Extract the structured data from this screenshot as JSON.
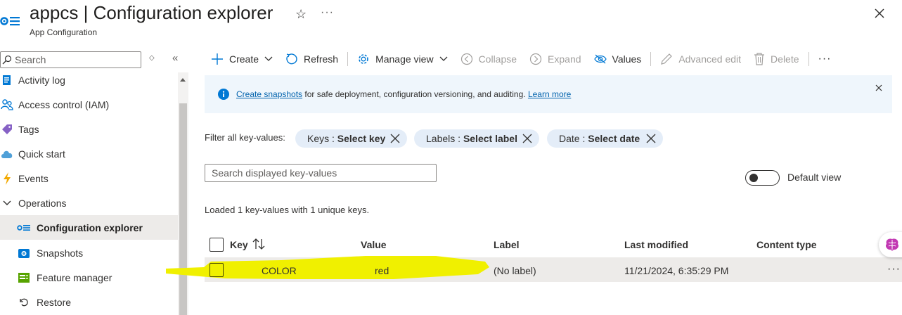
{
  "header": {
    "title": "appcs | Configuration explorer",
    "subtitle": "App Configuration",
    "more_glyph": "···"
  },
  "sidebar": {
    "search_placeholder": "Search",
    "items": [
      {
        "label": "Activity log",
        "icon": "activity-log-icon"
      },
      {
        "label": "Access control (IAM)",
        "icon": "people-icon"
      },
      {
        "label": "Tags",
        "icon": "tag-icon"
      },
      {
        "label": "Quick start",
        "icon": "cloud-icon"
      },
      {
        "label": "Events",
        "icon": "lightning-icon"
      },
      {
        "label": "Operations",
        "icon": "chevron-down-icon"
      },
      {
        "label": "Configuration explorer",
        "icon": "config-explorer-icon",
        "selected": true
      },
      {
        "label": "Snapshots",
        "icon": "camera-icon"
      },
      {
        "label": "Feature manager",
        "icon": "feature-manager-icon"
      },
      {
        "label": "Restore",
        "icon": "restore-icon"
      }
    ]
  },
  "toolbar": {
    "create": "Create",
    "refresh": "Refresh",
    "manage_view": "Manage view",
    "collapse": "Collapse",
    "expand": "Expand",
    "values": "Values",
    "advanced_edit": "Advanced edit",
    "delete": "Delete",
    "more": "···"
  },
  "banner": {
    "link1": "Create snapshots",
    "text": " for safe deployment, configuration versioning, and auditing. ",
    "link2": "Learn more"
  },
  "filters": {
    "label": "Filter all key-values:",
    "keys_prefix": "Keys : ",
    "keys_value": "Select key",
    "labels_prefix": "Labels : ",
    "labels_value": "Select label",
    "date_prefix": "Date : ",
    "date_value": "Select date"
  },
  "search": {
    "placeholder": "Search displayed key-values"
  },
  "toggle": {
    "label": "Default view",
    "on": false
  },
  "status": {
    "loaded": "Loaded 1 key-values with 1 unique keys."
  },
  "table": {
    "columns": [
      "Key",
      "Value",
      "Label",
      "Last modified",
      "Content type"
    ],
    "rows": [
      {
        "key": "COLOR",
        "value": "red",
        "label": "(No label)",
        "last_modified": "11/21/2024, 6:35:29 PM",
        "content_type": ""
      }
    ]
  },
  "colors": {
    "accent": "#0078d4",
    "banner_bg": "#eff6fc",
    "pill_bg": "#e4edf8",
    "highlight": "#f0f000"
  }
}
